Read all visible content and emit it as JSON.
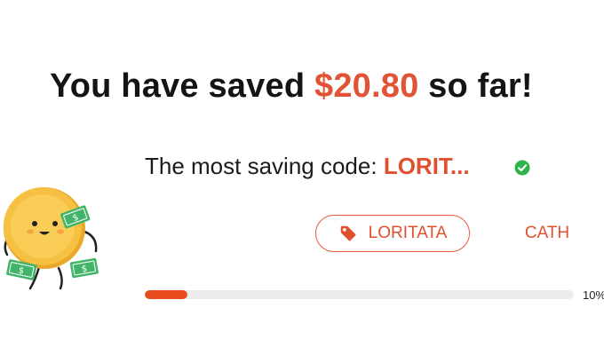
{
  "headline": {
    "prefix": "You have saved ",
    "amount": "$20.80",
    "suffix": " so far!"
  },
  "best_code": {
    "label": "The most saving code: ",
    "code": "LORIT..."
  },
  "codes": [
    {
      "label": "LORITATA",
      "selected": true
    },
    {
      "label": "CATH",
      "selected": false
    }
  ],
  "progress": {
    "value": 0.1,
    "label": "10%"
  },
  "icons": {
    "check": "check-circle-icon",
    "tag": "tag-icon",
    "mascot": "coin-mascot-illustration"
  },
  "colors": {
    "accent": "#e25335",
    "progress_fill": "#e84b1e",
    "check": "#2fb34a",
    "coin": "#f6c043",
    "money": "#41b46a"
  }
}
